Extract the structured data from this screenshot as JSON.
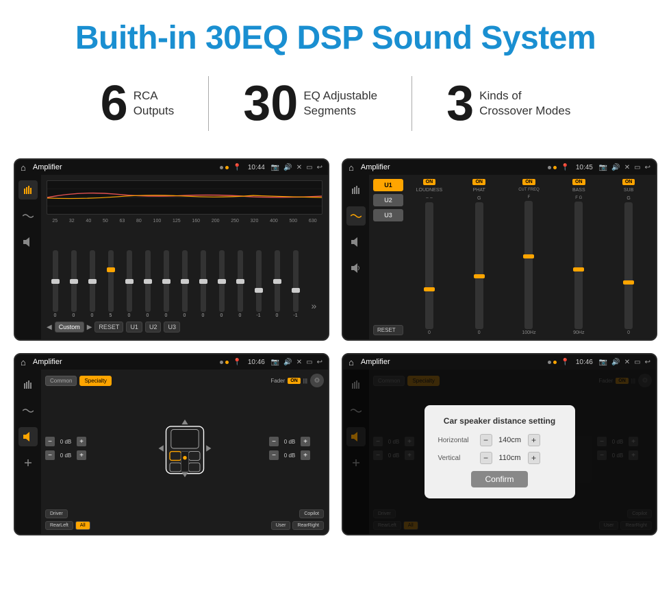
{
  "header": {
    "title": "Buith-in 30EQ DSP Sound System"
  },
  "stats": [
    {
      "number": "6",
      "text_line1": "RCA",
      "text_line2": "Outputs"
    },
    {
      "number": "30",
      "text_line1": "EQ Adjustable",
      "text_line2": "Segments"
    },
    {
      "number": "3",
      "text_line1": "Kinds of",
      "text_line2": "Crossover Modes"
    }
  ],
  "screens": {
    "eq_screen": {
      "title": "Amplifier",
      "time": "10:44",
      "freq_labels": [
        "25",
        "32",
        "40",
        "50",
        "63",
        "80",
        "100",
        "125",
        "160",
        "200",
        "250",
        "320",
        "400",
        "500",
        "630"
      ],
      "slider_values": [
        "0",
        "0",
        "0",
        "5",
        "0",
        "0",
        "0",
        "0",
        "0",
        "0",
        "0",
        "-1",
        "0",
        "-1"
      ],
      "bottom_buttons": [
        "Custom",
        "RESET",
        "U1",
        "U2",
        "U3"
      ]
    },
    "crossover_screen": {
      "title": "Amplifier",
      "time": "10:45",
      "u_buttons": [
        "U1",
        "U2",
        "U3"
      ],
      "channels": [
        {
          "name": "LOUDNESS",
          "on": true
        },
        {
          "name": "PHAT",
          "on": true
        },
        {
          "name": "CUT FREQ",
          "on": true
        },
        {
          "name": "BASS",
          "on": true
        },
        {
          "name": "SUB",
          "on": true
        }
      ],
      "reset_label": "RESET"
    },
    "speaker_screen": {
      "title": "Amplifier",
      "time": "10:46",
      "tabs": [
        "Common",
        "Specialty"
      ],
      "fader_label": "Fader",
      "on_badge": "ON",
      "vol_rows": [
        {
          "value": "0 dB"
        },
        {
          "value": "0 dB"
        },
        {
          "value": "0 dB"
        },
        {
          "value": "0 dB"
        }
      ],
      "bottom_buttons": [
        "Driver",
        "RearLeft",
        "All",
        "User",
        "RearRight",
        "Copilot"
      ]
    },
    "distance_screen": {
      "title": "Amplifier",
      "time": "10:46",
      "tabs": [
        "Common",
        "Specialty"
      ],
      "fader_label": "Fader",
      "on_badge": "ON",
      "dialog": {
        "title": "Car speaker distance setting",
        "horizontal_label": "Horizontal",
        "horizontal_value": "140cm",
        "vertical_label": "Vertical",
        "vertical_value": "110cm",
        "confirm_label": "Confirm"
      },
      "bottom_buttons": [
        "Driver",
        "RearLeft",
        "All",
        "User",
        "RearRight",
        "Copilot"
      ]
    }
  }
}
